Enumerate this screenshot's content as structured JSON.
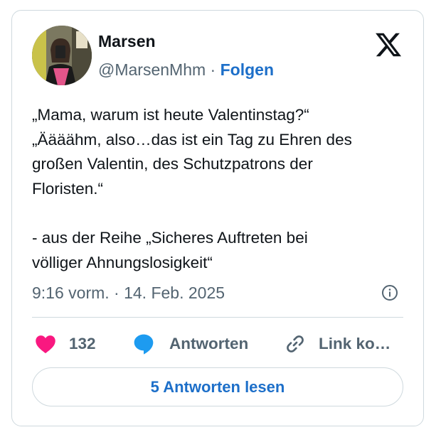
{
  "author": {
    "name": "Marsen",
    "handle": "@MarsenMhm",
    "separator": " · ",
    "follow_label": "Folgen"
  },
  "tweet": {
    "lines": [
      "„Mama, warum ist heute Valentinstag?“",
      "„Äääähm, also…das ist ein Tag zu Ehren des",
      "großen Valentin, des Schutzpatrons der",
      "Floristen.“",
      "",
      "- aus der Reihe „Sicheres Auftreten bei",
      "völliger Ahnungslosigkeit“"
    ],
    "timestamp": "9:16 vorm. · 14. Feb. 2025"
  },
  "actions": {
    "like_count": "132",
    "reply_label": "Antworten",
    "copy_link_label": "Link ko…"
  },
  "read_replies_label": "5 Antworten lesen",
  "colors": {
    "accent": "#1d6fc9",
    "like": "#f91880",
    "reply_bubble": "#1d9bf0",
    "muted": "#536471",
    "border": "#cfd9de"
  },
  "icons": [
    "x-logo-icon",
    "heart-icon",
    "reply-bubble-icon",
    "link-icon",
    "info-icon"
  ]
}
